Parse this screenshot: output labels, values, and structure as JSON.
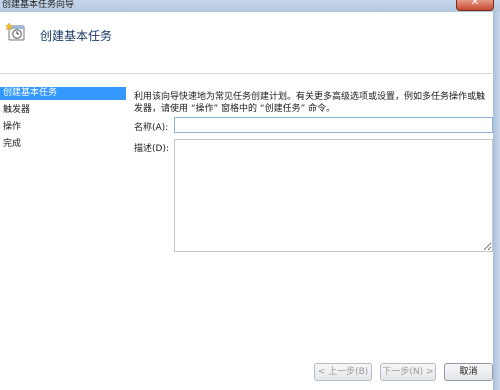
{
  "window": {
    "title": "创建基本任务向导",
    "close_label": "✕"
  },
  "header": {
    "title": "创建基本任务",
    "icon": "task-clock-icon"
  },
  "nav": {
    "items": [
      {
        "label": "创建基本任务",
        "active": true
      },
      {
        "label": "触发器",
        "active": false
      },
      {
        "label": "操作",
        "active": false
      },
      {
        "label": "完成",
        "active": false
      }
    ]
  },
  "main": {
    "description": "利用该向导快速地为常见任务创建计划。有关更多高级选项或设置，例如多任务操作或触发器，请使用 “操作” 窗格中的 “创建任务” 命令。",
    "name_label": "名称(A):",
    "name_value": "",
    "desc_label": "描述(D):",
    "desc_value": ""
  },
  "buttons": {
    "back": "< 上一步(B)",
    "next": "下一步(N) >",
    "cancel": "取消"
  },
  "colors": {
    "accent": "#3399ff",
    "frame": "#b9cbe0",
    "close": "#c74a33"
  }
}
